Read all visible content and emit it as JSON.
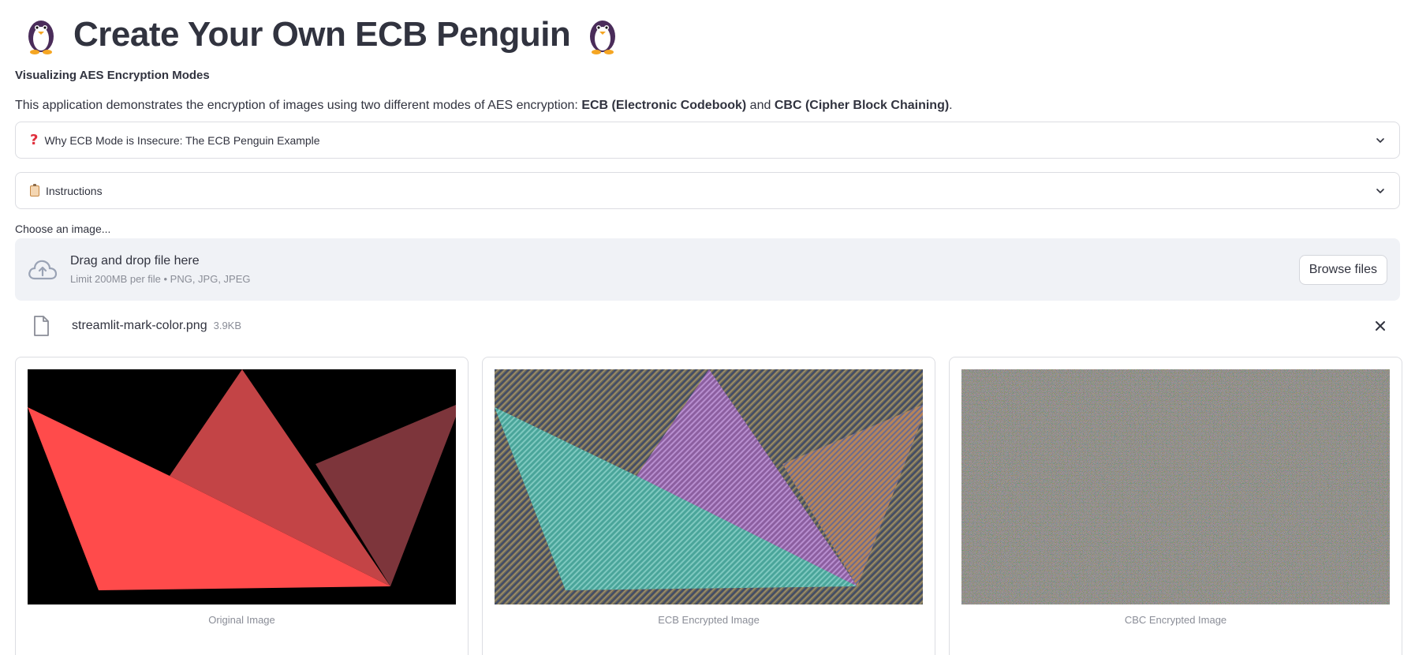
{
  "header": {
    "title": "Create Your Own ECB Penguin",
    "left_icon": "penguin-emoji",
    "right_icon": "penguin-emoji"
  },
  "subtitle": "Visualizing AES Encryption Modes",
  "intro": {
    "prefix": "This application demonstrates the encryption of images using two different modes of AES encryption: ",
    "ecb": "ECB (Electronic Codebook)",
    "middle": " and ",
    "cbc": "CBC (Cipher Block Chaining)",
    "suffix": "."
  },
  "expanders": [
    {
      "label": "Why ECB Mode is Insecure: The ECB Penguin Example",
      "icon": "question-mark-icon"
    },
    {
      "label": "Instructions",
      "icon": "clipboard-icon"
    }
  ],
  "uploader": {
    "label": "Choose an image...",
    "drop_text": "Drag and drop file here",
    "limit_text": "Limit 200MB per file • PNG, JPG, JPEG",
    "browse_label": "Browse files"
  },
  "uploaded_file": {
    "name": "streamlit-mark-color.png",
    "size": "3.9KB"
  },
  "images": [
    {
      "caption": "Original Image"
    },
    {
      "caption": "ECB Encrypted Image"
    },
    {
      "caption": "CBC Encrypted Image"
    }
  ],
  "colors": {
    "text": "#31333f",
    "muted": "#8a8d97",
    "dropzone_bg": "#f0f2f6",
    "border": "#dcdde2",
    "logo_red": "#ff4b4b",
    "logo_mid": "#c34446",
    "logo_dark": "#7d353b"
  }
}
